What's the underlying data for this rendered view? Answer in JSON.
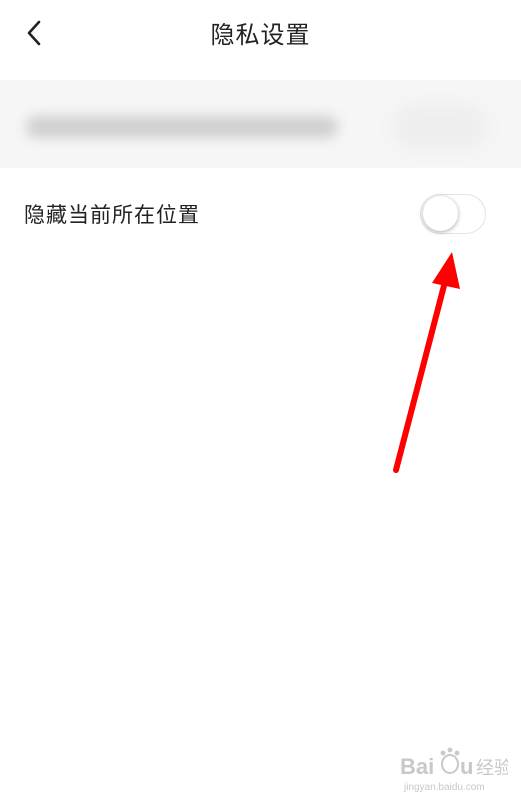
{
  "header": {
    "title": "隐私设置",
    "back_icon": "chevron-left-icon"
  },
  "settings": {
    "hide_location": {
      "label": "隐藏当前所在位置",
      "enabled": false
    }
  },
  "annotation": {
    "color": "#ff0000"
  },
  "watermark": {
    "brand": "Baidu",
    "sub": "经验",
    "url": "jingyan.baidu.com"
  }
}
